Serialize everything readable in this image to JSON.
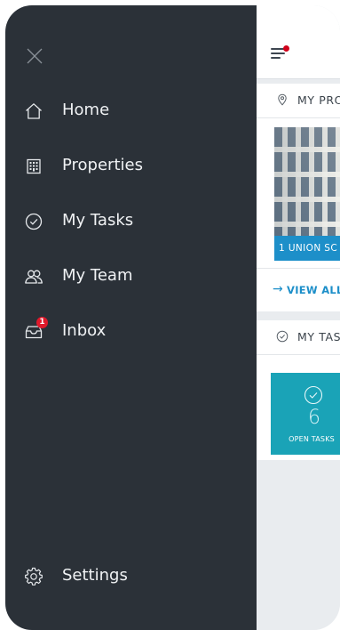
{
  "colors": {
    "drawer_bg": "#2b3138",
    "accent_blue": "#1d8fc9",
    "tile_teal": "#1aa3b7",
    "badge_red": "#e0192b",
    "content_bg": "#e9ecef"
  },
  "drawer": {
    "close_icon": "close-icon",
    "items": [
      {
        "label": "Home",
        "icon": "home-icon"
      },
      {
        "label": "Properties",
        "icon": "building-icon"
      },
      {
        "label": "My Tasks",
        "icon": "check-circle-icon"
      },
      {
        "label": "My Team",
        "icon": "team-icon"
      },
      {
        "label": "Inbox",
        "icon": "inbox-icon",
        "badge": "1"
      }
    ],
    "settings": {
      "label": "Settings",
      "icon": "gear-icon"
    }
  },
  "main": {
    "my_properties": {
      "title": "MY PRO",
      "icon": "location-pin-icon"
    },
    "property_card": {
      "label": "1 UNION SC"
    },
    "view_all": {
      "label": "VIEW ALL",
      "icon": "arrow-right-icon"
    },
    "my_tasks": {
      "title": "MY TAS",
      "icon": "check-circle-icon"
    },
    "open_tasks": {
      "count": "6",
      "label": "OPEN TASKS"
    }
  }
}
